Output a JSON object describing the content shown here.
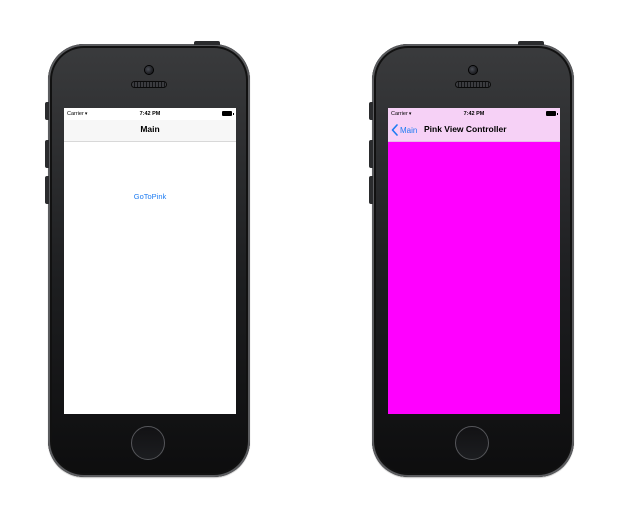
{
  "phones": {
    "left": {
      "status": {
        "carrier": "Carrier",
        "time": "7:42 PM"
      },
      "nav_title": "Main",
      "link_label": "GoToPink",
      "screen_color": "#ffffff"
    },
    "right": {
      "status": {
        "carrier": "Carrier",
        "time": "7:42 PM"
      },
      "back_label": "Main",
      "nav_title": "Pink View Controller",
      "screen_color": "#ff00ff"
    }
  },
  "colors": {
    "accent": "#1e7cf2",
    "pink": "#ff00ff",
    "pink_nav": "#f6d1f6"
  },
  "icons": {
    "status": [
      "wifi-icon",
      "battery-icon"
    ],
    "nav": [
      "chevron-left-icon"
    ],
    "device": [
      "camera-icon",
      "speaker-icon",
      "home-button"
    ]
  }
}
